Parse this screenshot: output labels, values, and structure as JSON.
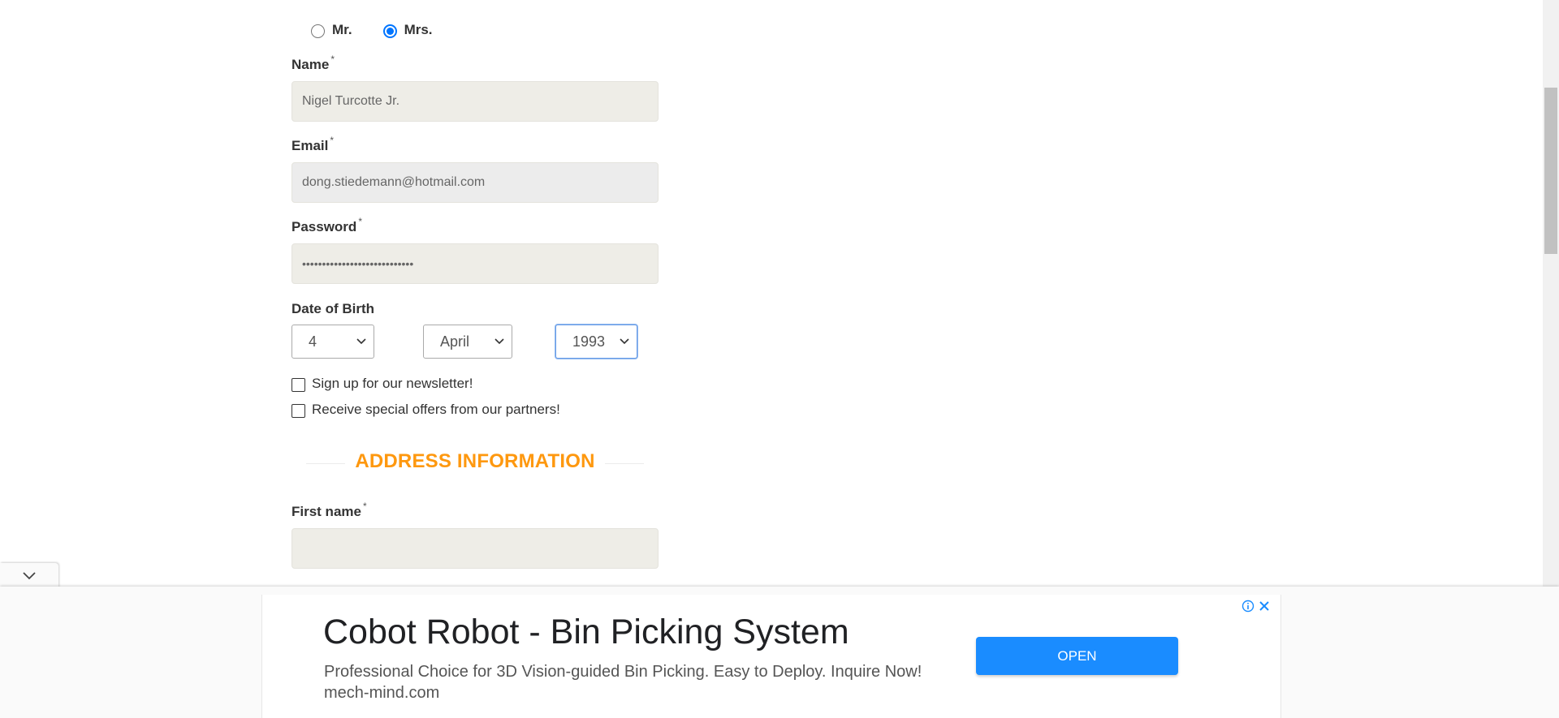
{
  "title_options": [
    {
      "label": "Mr.",
      "checked": false
    },
    {
      "label": "Mrs.",
      "checked": true
    }
  ],
  "form": {
    "name_label": "Name",
    "name_value": "Nigel Turcotte Jr.",
    "email_label": "Email",
    "email_value": "dong.stiedemann@hotmail.com",
    "password_label": "Password",
    "password_value": "••••••••••••••••••••••••••••",
    "required_mark": "*",
    "dob_label": "Date of Birth",
    "dob_day": "4",
    "dob_month": "April",
    "dob_year": "1993",
    "newsletter_label": "Sign up for our newsletter!",
    "offers_label": "Receive special offers from our partners!",
    "address_heading": "ADDRESS INFORMATION",
    "first_name_label": "First name",
    "first_name_value": ""
  },
  "ad": {
    "title": "Cobot Robot - Bin Picking System",
    "description": "Professional Choice for 3D Vision-guided Bin Picking. Easy to Deploy. Inquire Now! mech-mind.com",
    "button_label": "OPEN"
  },
  "colors": {
    "accent_orange": "#fe980f",
    "radio_blue": "#0075ff",
    "ad_button": "#1a8cff",
    "input_bg": "#eeede7"
  },
  "icons": {
    "collapse": "chevron-down-icon",
    "select_arrow": "chevron-down-icon",
    "ad_info": "info-icon",
    "ad_close": "close-icon"
  }
}
